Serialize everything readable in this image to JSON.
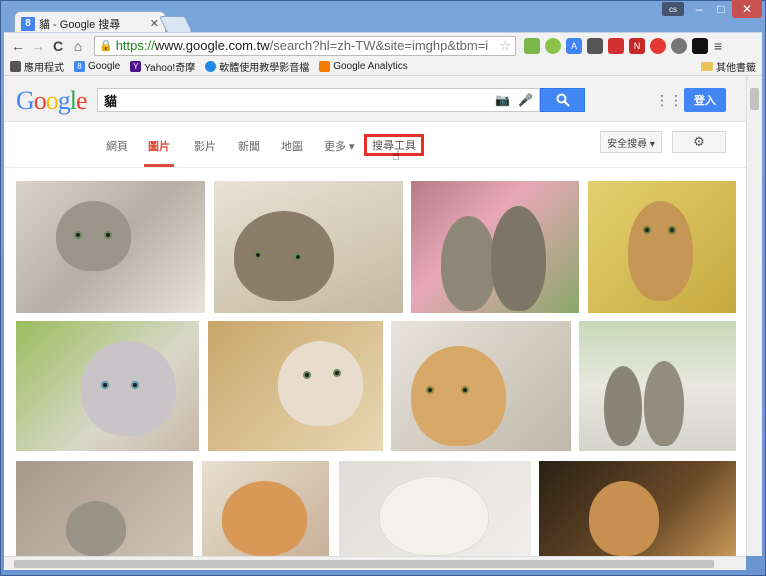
{
  "window": {
    "tab_title": "貓 - Google 搜尋",
    "tab_favicon": "8",
    "user_badge": "cs",
    "minimize": "–",
    "maximize": "□",
    "close": "✕"
  },
  "toolbar": {
    "back": "←",
    "forward": "→",
    "reload": "C",
    "home": "⌂",
    "url_scheme": "https://",
    "url_host": "www.google.com.tw",
    "url_rest": "/search?hl=zh-TW&site=imghp&tbm=i"
  },
  "bookmarks": {
    "items": [
      "應用程式",
      "Google",
      "Yahoo!奇摩",
      "軟體使用教學影音檔",
      "Google Analytics"
    ],
    "other": "其他書籤"
  },
  "header": {
    "query": "貓",
    "signin": "登入"
  },
  "tabs": {
    "web": "網頁",
    "images": "圖片",
    "videos": "影片",
    "news": "新聞",
    "maps": "地圖",
    "more": "更多 ▾",
    "tools": "搜尋工具",
    "safe_search": "安全搜尋 ▾"
  },
  "colors": {
    "brand_blue": "#4285f4",
    "active_tab_red": "#dd4b39",
    "highlight_red": "#e53224"
  }
}
